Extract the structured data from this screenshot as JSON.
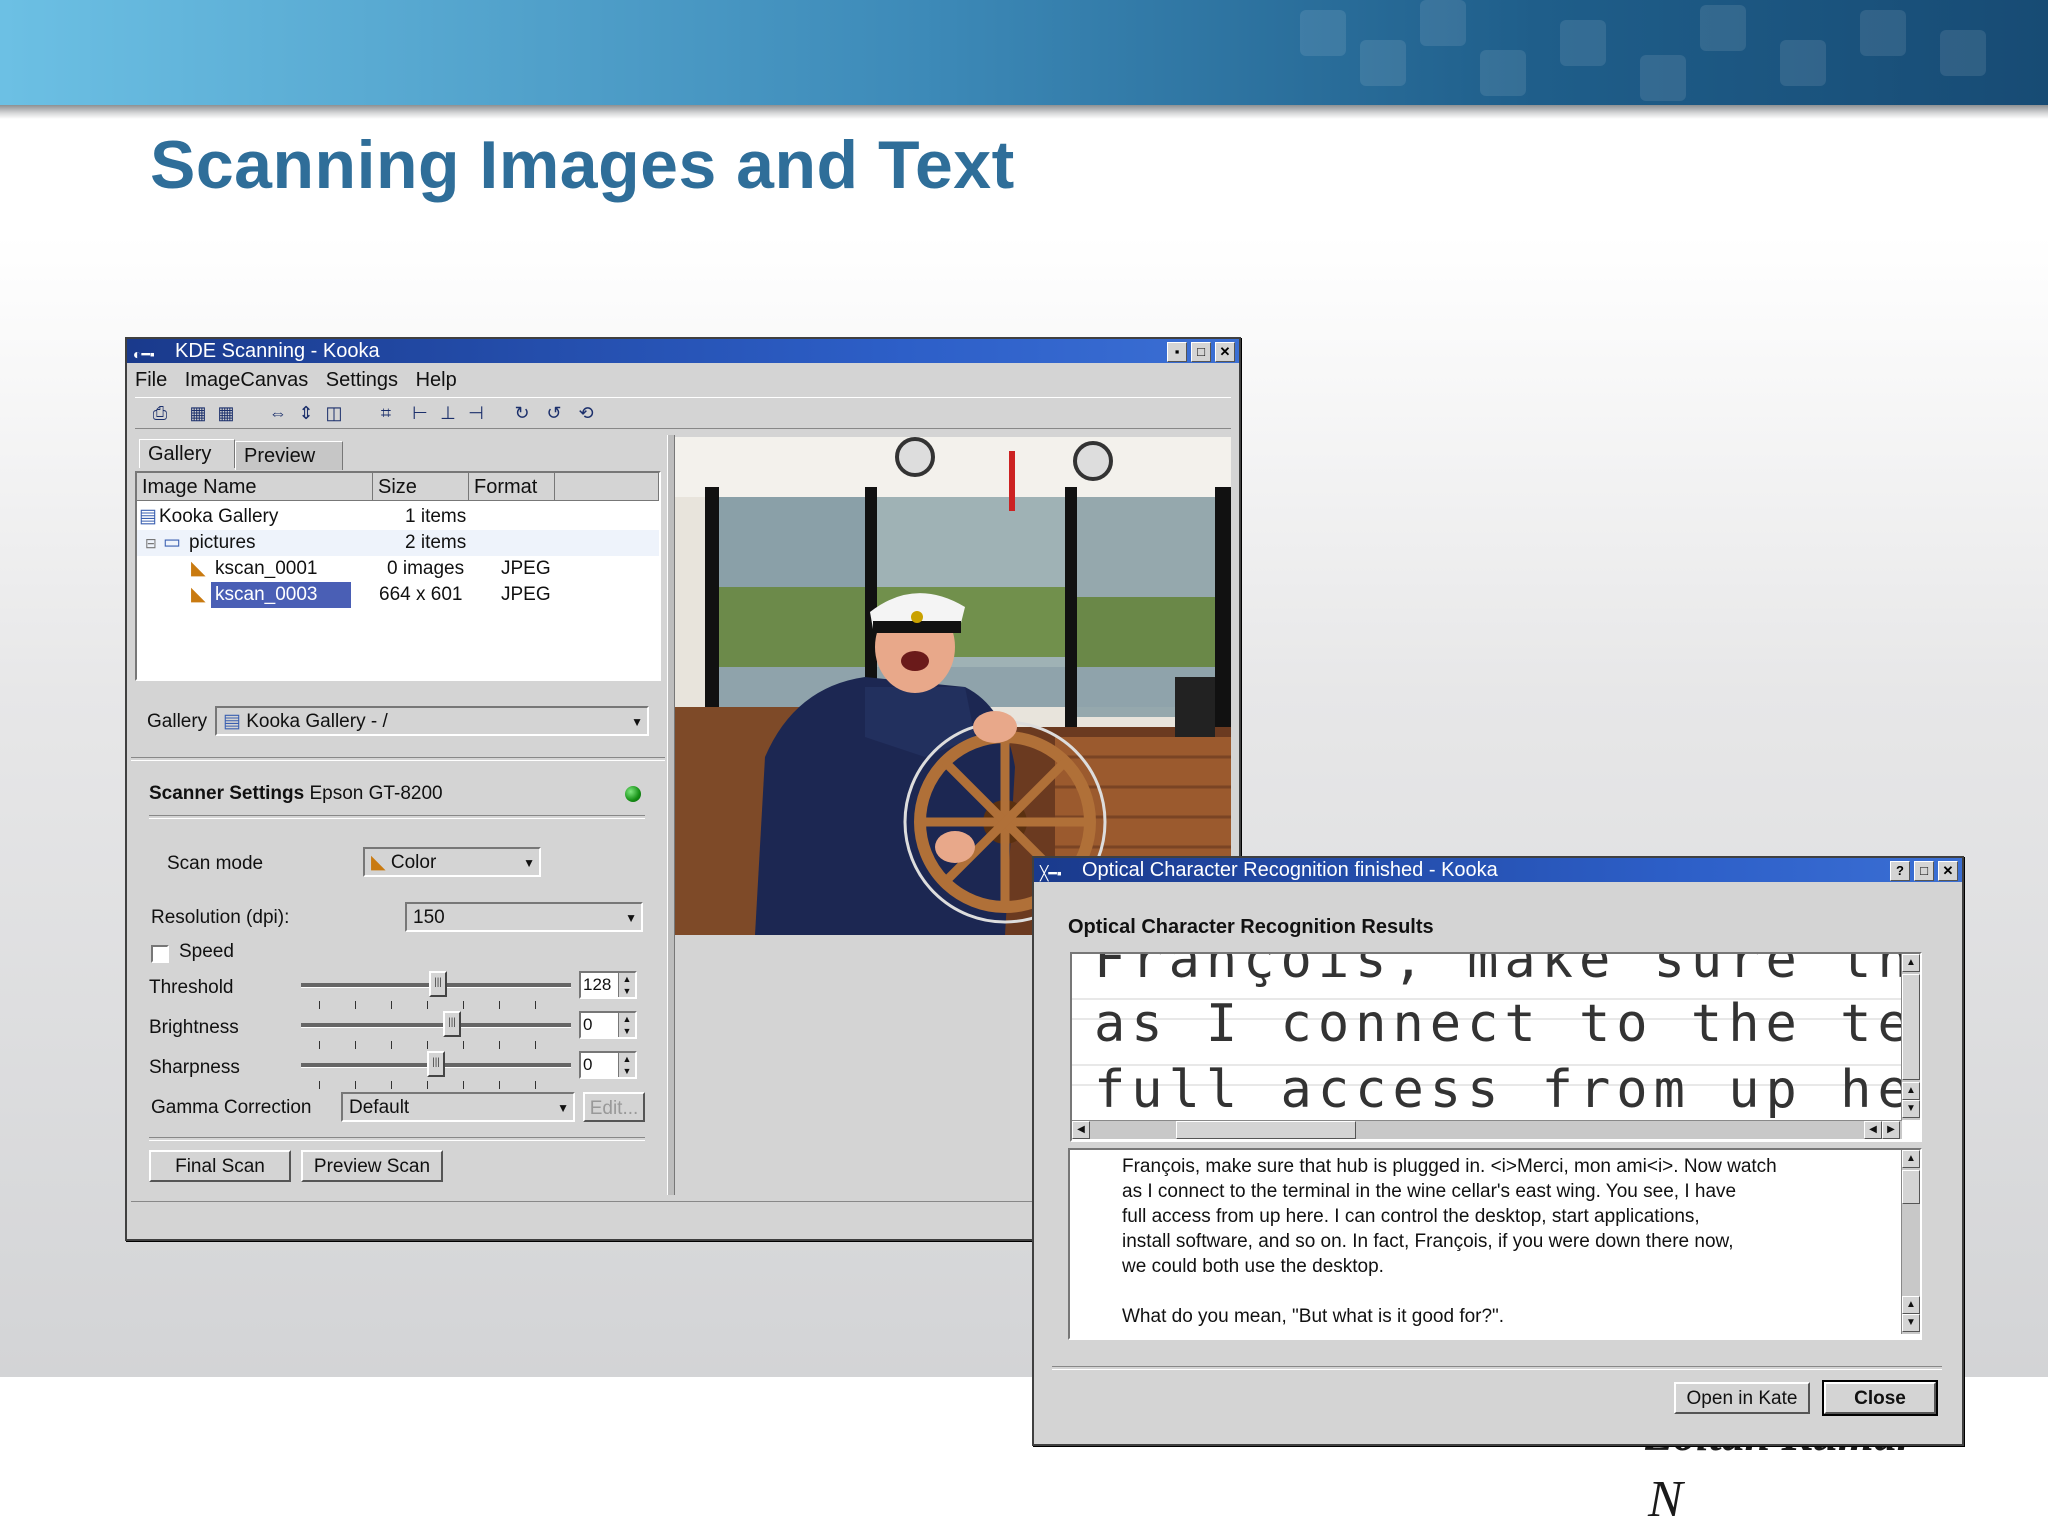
{
  "slide": {
    "title": "Scanning Images and Text",
    "author_line1": "Zoltan Kumar",
    "author_line2": "N"
  },
  "kooka": {
    "window_title": "KDE Scanning - Kooka",
    "menu": [
      "File",
      "ImageCanvas",
      "Settings",
      "Help"
    ],
    "tabs": [
      "Gallery",
      "Preview"
    ],
    "columns": [
      "Image Name",
      "Size",
      "Format"
    ],
    "rows": [
      {
        "name": "Kooka Gallery",
        "size": "1 items",
        "format": ""
      },
      {
        "name": "pictures",
        "size": "2 items",
        "format": ""
      },
      {
        "name": "kscan_0001",
        "size": "0 images",
        "format": "JPEG"
      },
      {
        "name": "kscan_0003",
        "size": "664 x 601",
        "format": "JPEG"
      }
    ],
    "gallery_label": "Gallery",
    "gallery_value": "Kooka Gallery - /",
    "scanner_settings_label": "Scanner Settings",
    "scanner_name": "Epson GT-8200",
    "scan_mode_label": "Scan mode",
    "scan_mode_value": "Color",
    "resolution_label": "Resolution (dpi):",
    "resolution_value": "150",
    "speed_label": "Speed",
    "threshold_label": "Threshold",
    "threshold_value": "128",
    "brightness_label": "Brightness",
    "brightness_value": "0",
    "sharpness_label": "Sharpness",
    "sharpness_value": "0",
    "gamma_label": "Gamma Correction",
    "gamma_value": "Default",
    "edit_label": "Edit...",
    "final_scan": "Final Scan",
    "preview_scan": "Preview Scan"
  },
  "ocr": {
    "window_title": "Optical Character Recognition finished - Kooka",
    "heading": "Optical Character Recognition Results",
    "image_lines": [
      "François, make sure tha",
      "as I connect to the ter",
      "full access from up her"
    ],
    "text_lines": [
      "François, make sure that hub is plugged in.  <i>Merci, mon ami<i>.  Now watch",
      "as I connect to the terminal in the wine cellar's east wing.  You see,  I have",
      "full access from up here.  I can control the desktop,  start applications,",
      "install software,  and so on.  In fact, François,  if you were down there now,",
      "we could both use the desktop.",
      "",
      "What do you mean,  \"But what is it good for?\"."
    ],
    "open_in_kate": "Open in Kate",
    "close": "Close"
  },
  "colors": {
    "title": "#2f6e99",
    "titlebar": "#2d5fc8",
    "selection": "#4a5fb5"
  }
}
